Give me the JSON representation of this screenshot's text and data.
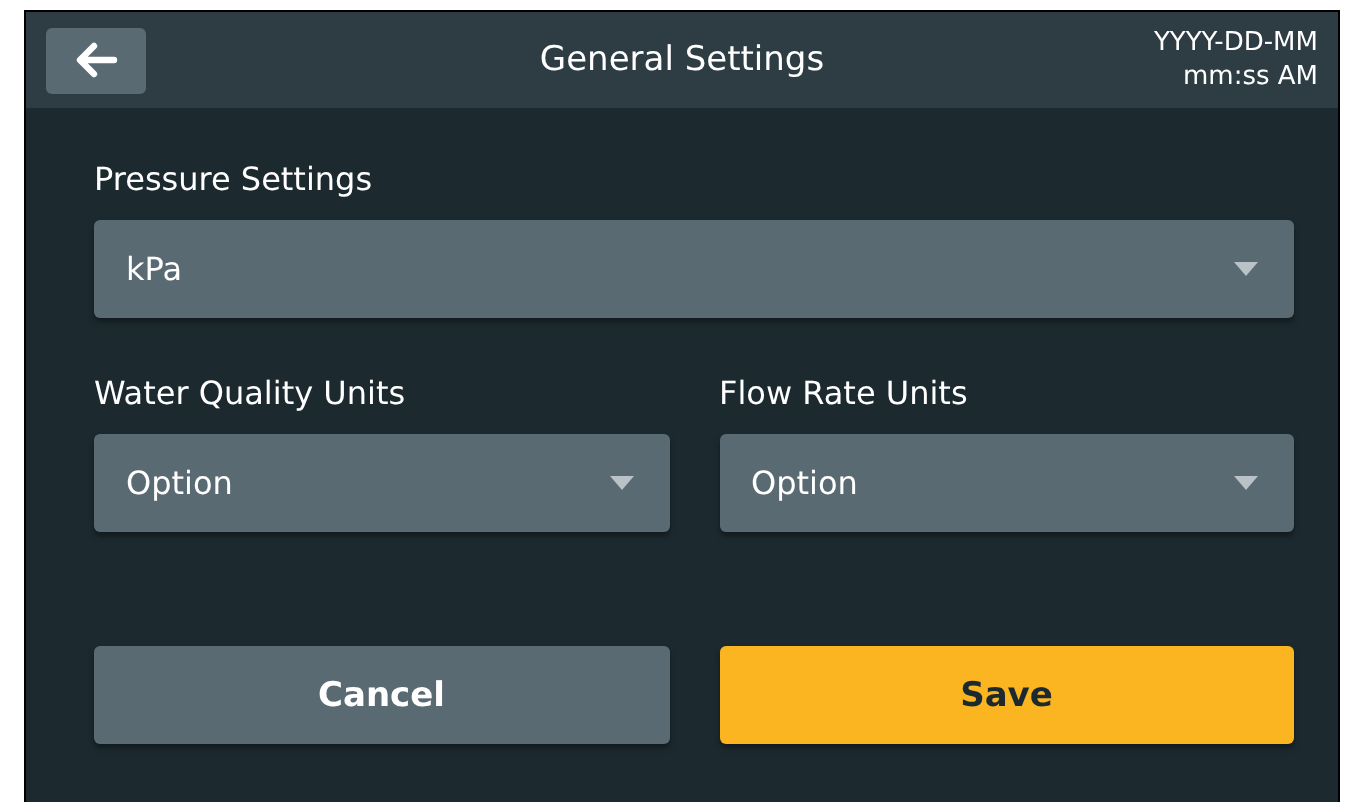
{
  "header": {
    "title": "General Settings",
    "date": "YYYY-DD-MM",
    "time": "mm:ss AM"
  },
  "fields": [
    {
      "label": "Pressure Settings",
      "value": "kPa",
      "kind": "wide"
    },
    {
      "label": "Water Quality Units",
      "value": "Option",
      "kind": "narrow"
    },
    {
      "label": "Flow Rate Units",
      "value": "Option",
      "kind": "narrow"
    }
  ],
  "buttons": [
    {
      "label": "Cancel",
      "kind": "secondary"
    },
    {
      "label": "Save",
      "kind": "primary"
    }
  ]
}
